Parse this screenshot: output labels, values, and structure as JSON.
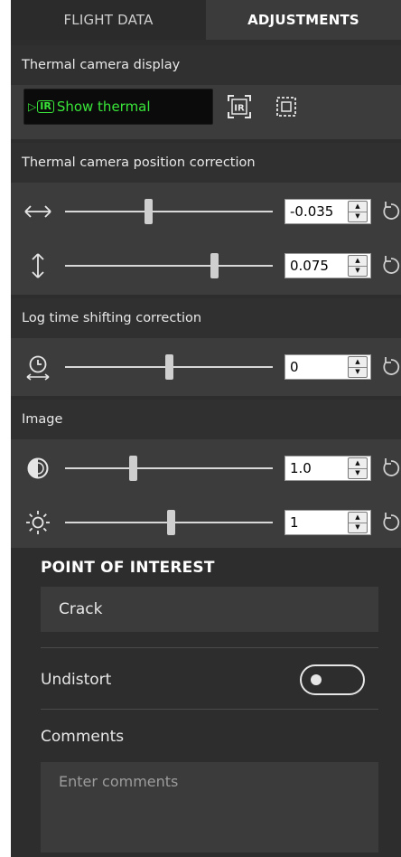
{
  "tabs": [
    {
      "label": "FLIGHT DATA",
      "active": false
    },
    {
      "label": "ADJUSTMENTS",
      "active": true
    }
  ],
  "thermal_display": {
    "section_label": "Thermal camera display",
    "button_badge": "IR",
    "button_label": "Show thermal",
    "accent_color": "#39e639",
    "icons": [
      "ir-frame-icon",
      "select-region-icon"
    ]
  },
  "position_correction": {
    "section_label": "Thermal camera position correction",
    "horizontal": {
      "icon": "horizontal-arrows-icon",
      "value": "-0.035",
      "level": 0.4
    },
    "vertical": {
      "icon": "vertical-arrows-icon",
      "value": "0.075",
      "level": 0.72
    }
  },
  "time_shift": {
    "section_label": "Log time shifting correction",
    "offset": {
      "icon": "clock-shift-icon",
      "value": "0",
      "level": 0.5
    }
  },
  "image": {
    "section_label": "Image",
    "contrast": {
      "icon": "contrast-icon",
      "value": "1.0",
      "level": 0.33
    },
    "brightness": {
      "icon": "brightness-icon",
      "value": "1",
      "level": 0.51
    }
  },
  "poi": {
    "title": "POINT OF INTEREST",
    "type_value": "Crack",
    "undistort_label": "Undistort",
    "undistort_on": false,
    "comments_label": "Comments",
    "comments_placeholder": "Enter comments"
  }
}
